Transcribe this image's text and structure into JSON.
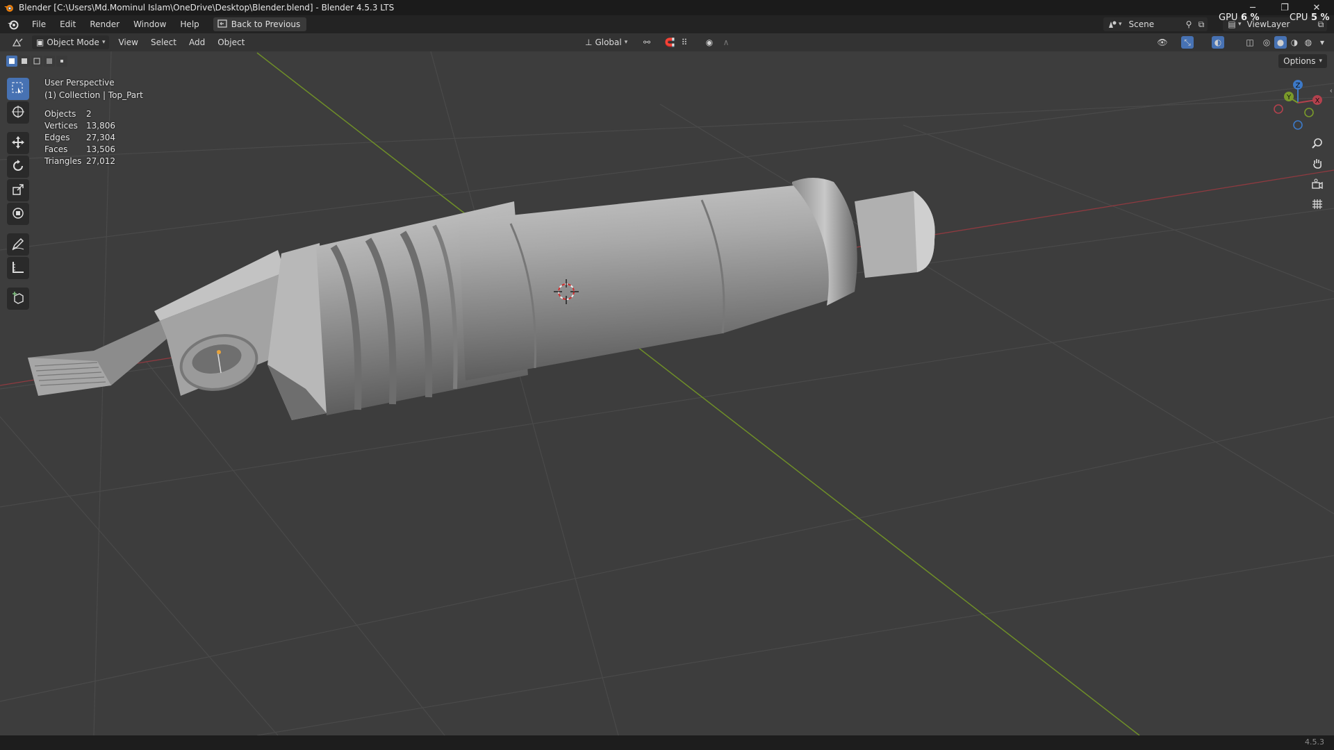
{
  "window": {
    "title": "Blender [C:\\Users\\Md.Mominul Islam\\OneDrive\\Desktop\\Blender.blend] - Blender 4.5.3 LTS",
    "controls": {
      "minimize": "─",
      "restore": "❐",
      "close": "✕"
    }
  },
  "menubar": {
    "items": [
      "File",
      "Edit",
      "Render",
      "Window",
      "Help"
    ],
    "back_button": "Back to Previous",
    "scene_label": "Scene",
    "viewlayer_label": "ViewLayer",
    "gpu_label": "GPU",
    "gpu_value": "6 %",
    "cpu_label": "CPU",
    "cpu_value": "5 %"
  },
  "viewport_header": {
    "mode": "Object Mode",
    "menus": [
      "View",
      "Select",
      "Add",
      "Object"
    ],
    "orientation": "Global",
    "options_label": "Options"
  },
  "overlay": {
    "perspective": "User Perspective",
    "collection": "(1) Collection | Top_Part",
    "stats": [
      {
        "label": "Objects",
        "value": "2"
      },
      {
        "label": "Vertices",
        "value": "13,806"
      },
      {
        "label": "Edges",
        "value": "27,304"
      },
      {
        "label": "Faces",
        "value": "13,506"
      },
      {
        "label": "Triangles",
        "value": "27,012"
      }
    ]
  },
  "gizmo": {
    "x": "X",
    "y": "Y",
    "z": "Z"
  },
  "statusbar": {
    "version": "4.5.3"
  },
  "colors": {
    "accent": "#4772b3",
    "x_axis": "#b3414d",
    "y_axis": "#7a9a2a",
    "z_axis": "#3c79c8",
    "origin": "#e8a33a"
  }
}
